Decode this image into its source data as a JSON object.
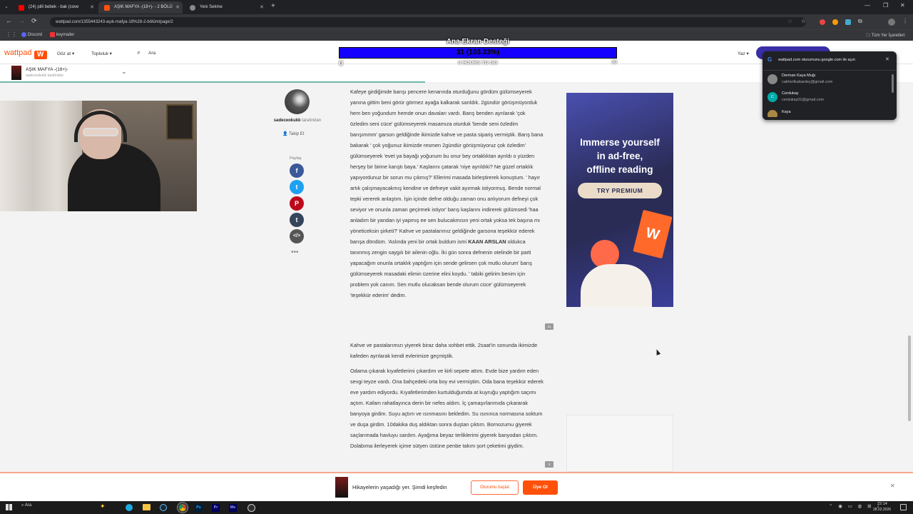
{
  "browser": {
    "tabs": [
      {
        "title": "(24) pilli bebek - bak (cove"
      },
      {
        "title": "AŞIK MAFYA -(18+)- - 2 BÖLÜ"
      },
      {
        "title": "Yeni Sekme"
      }
    ],
    "new_tab": "+",
    "url": "wattpad.com/1355443243-aşık-mafya-18%28-2-bölüm/page/2",
    "bookmarks": [
      {
        "label": "Discord"
      },
      {
        "label": "keymailer"
      }
    ],
    "all_bookmarks": "Tüm Yer İşaretleri"
  },
  "overlay": {
    "title": "Ana Ekran Desteği",
    "bar_text": "31 (103.33%)",
    "bar_fill": 1.0,
    "min": "0",
    "center": "0 HOURS TO GO",
    "max": "30"
  },
  "header": {
    "logo": "wattpad",
    "browse": "Göz at",
    "community": "Topluluk",
    "search_placeholder": "Ara",
    "write": "Yaz"
  },
  "story": {
    "title": "AŞIK MAFYA -(18+)-",
    "author_line": "sadeceokukk tarafından",
    "author": "sadeceokukk",
    "author_suffix": "tarafından",
    "follow": "Takip Et",
    "share_label": "Paylaş",
    "reading_progress": 0.47,
    "paragraphs": [
      {
        "text": "Kafeye girdiğimde barışı pencere kenarında oturduğunu gördüm gülümseyerek yanına gittim beni görür görmez ayağa kalkarak sarıldık. 2gündür görüşmüyorduk hem ben yoğundum hemde onun davaları vardı. Barış benden ayrılarak 'çok özledim seni cüce' gülümseyerek masamıza oturduk 'bende seni özledim barışımmm' garson geldiğinde ikimizde kahve ve pasta sipariş vermiştik. Barış bana bakarak ' çok yoğunuz ikimizde resmen 2gündür görüşmüyoruz çok özledim' gülümseyerek 'evet ya bayağı yoğunum bu onur bey ortaklıktan ayrıldı o yüzden herşey bir birine karıştı baya.' Kaşlarını çatarak 'niye ayrıldıki? Ne güzel ortaklık yapıyordunuz bir sorun mu çıkmış?' Ellerimi masada birleştirerek konuştum. ' hayır artık çalışmayacakmış kendine ve defneye vakit ayırmak istiyormuş. Bende normal tepki vererek anlaştım. İşin içinde defne olduğu zaman onu anlıyorum defneyi çok seviyor ve onunla zaman geçirmek istiyor' barış kaşlarını indirerek gülümsedi 'haa anladım bir yandan iyi yapmış ee sen bulucakmısın yeni ortak yoksa tek başına mı yöneticeksin şirketi?' Kahve ve pastalarımız geldiğinde garsona teşekkür ederek barışa döndüm. 'Aslında yeni bir ortak buldum ismi ",
        "bold": "KAAN ARSLAN",
        "text2": " oldukca tanınmış zengin saygılı bir ailenin oğlu. İki gün sonra defnenin otelinde bir parti yapacağım onunla ortaklık yaptığım için sende gelirsen çok mutlu olurum' barış gülümseyerek masadaki elimin üzerine elini koydu. ' tabiki gelirim benim için problem yok canım. Sen mutlu olucaksan bende olurum cüce' gülümseyerek 'teşekkür ederim' dedim.",
        "comments": "11"
      },
      {
        "text": "Kahve ve pastalarımızı yiyerek biraz daha sohbet ettik. 2saat'in sonunda ikimizde kafeden ayrılarak kendi evlerimize geçmiştik.",
        "bold": "",
        "text2": "",
        "comments": ""
      },
      {
        "text": "Odama çıkarak kıyafetlerimi çıkardım ve kirli sepete attım. Evde bize yardım eden sevgi teyze vardı. Ona bahçedeki orta boy evi vermiştim. Oda bana teşekkür ederek eve yardım ediyordu. Kıyafetlerimden kurtulduğumda at kuyruğu yaptığım saçımı açtım. Kafam rahatlayınca derin bir nefes aldım. İç çamaşırlarımıda çıkararak banyoya girdim. Suyu açtım ve ısınmasını bekledim. Su ısınınca normasına soktum ve duşa girdim. 10dakika duş aldıktan sonra duştan çıktım. Bornozumu giyerek saçlarımada havluyu sardım. Ayağıma beyaz terliklerimi giyerek banyodan çıktım. Dolabıma ilerleyerek içime sütyen üstüne penbe takım şort çeketimi giydim.",
        "bold": "",
        "text2": "",
        "comments": "3"
      }
    ]
  },
  "ad": {
    "line1": "Immerse yourself",
    "line2": "in ad-free,",
    "line3": "offline reading",
    "cta": "TRY PREMIUM"
  },
  "google_popup": {
    "title": "wattpad.com oturumunu google.com ile açın",
    "accounts": [
      {
        "name": "Derman Kaya Muğı",
        "email": "cakhertkabardey@gmail.com",
        "initial": ""
      },
      {
        "name": "Cerdukay",
        "email": "cerdukay01@gmail.com",
        "initial": "C"
      },
      {
        "name": "Kaya",
        "email": "",
        "initial": ""
      }
    ]
  },
  "bottom_banner": {
    "text": "Hikayelerin yaşadığı yer. Şimdi keşfedin",
    "login": "Oturumu başlat",
    "signup": "Üye Ol"
  },
  "taskbar": {
    "search": "Ara",
    "time": "22:14",
    "date": "28.02.2026"
  },
  "colors": {
    "wattpad_orange": "#ff500a",
    "overlay_bar": "#1500ff",
    "facebook": "#3b5998",
    "twitter": "#1da1f2",
    "pinterest": "#bd081c",
    "tumblr": "#35465c",
    "embed": "#555555"
  }
}
